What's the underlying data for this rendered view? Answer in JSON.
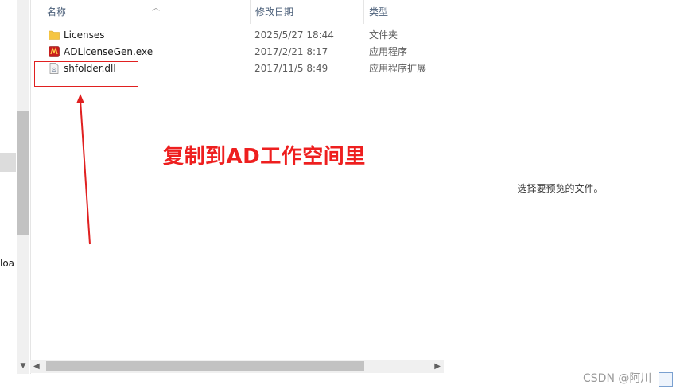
{
  "columns": {
    "name": "名称",
    "date": "修改日期",
    "type": "类型"
  },
  "files": [
    {
      "name": "Licenses",
      "date": "2025/5/27 18:44",
      "type": "文件夹",
      "icon": "folder-icon"
    },
    {
      "name": "ADLicenseGen.exe",
      "date": "2017/2/21 8:17",
      "type": "应用程序",
      "icon": "exe-icon"
    },
    {
      "name": "shfolder.dll",
      "date": "2017/11/5 8:49",
      "type": "应用程序扩展",
      "icon": "dll-icon"
    }
  ],
  "preview": {
    "message": "选择要预览的文件。"
  },
  "nav": {
    "partial_label": "loa"
  },
  "annotation": {
    "text": "复制到AD工作空间里",
    "color": "#ee1f1f"
  },
  "watermark": {
    "text": "CSDN @阿川"
  }
}
